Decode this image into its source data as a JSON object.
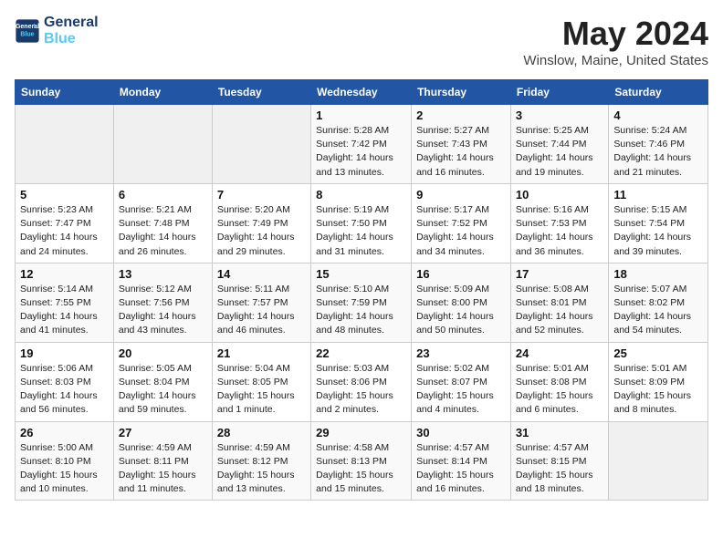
{
  "header": {
    "logo_line1": "General",
    "logo_line2": "Blue",
    "month": "May 2024",
    "location": "Winslow, Maine, United States"
  },
  "weekdays": [
    "Sunday",
    "Monday",
    "Tuesday",
    "Wednesday",
    "Thursday",
    "Friday",
    "Saturday"
  ],
  "weeks": [
    [
      {
        "day": "",
        "detail": ""
      },
      {
        "day": "",
        "detail": ""
      },
      {
        "day": "",
        "detail": ""
      },
      {
        "day": "1",
        "detail": "Sunrise: 5:28 AM\nSunset: 7:42 PM\nDaylight: 14 hours\nand 13 minutes."
      },
      {
        "day": "2",
        "detail": "Sunrise: 5:27 AM\nSunset: 7:43 PM\nDaylight: 14 hours\nand 16 minutes."
      },
      {
        "day": "3",
        "detail": "Sunrise: 5:25 AM\nSunset: 7:44 PM\nDaylight: 14 hours\nand 19 minutes."
      },
      {
        "day": "4",
        "detail": "Sunrise: 5:24 AM\nSunset: 7:46 PM\nDaylight: 14 hours\nand 21 minutes."
      }
    ],
    [
      {
        "day": "5",
        "detail": "Sunrise: 5:23 AM\nSunset: 7:47 PM\nDaylight: 14 hours\nand 24 minutes."
      },
      {
        "day": "6",
        "detail": "Sunrise: 5:21 AM\nSunset: 7:48 PM\nDaylight: 14 hours\nand 26 minutes."
      },
      {
        "day": "7",
        "detail": "Sunrise: 5:20 AM\nSunset: 7:49 PM\nDaylight: 14 hours\nand 29 minutes."
      },
      {
        "day": "8",
        "detail": "Sunrise: 5:19 AM\nSunset: 7:50 PM\nDaylight: 14 hours\nand 31 minutes."
      },
      {
        "day": "9",
        "detail": "Sunrise: 5:17 AM\nSunset: 7:52 PM\nDaylight: 14 hours\nand 34 minutes."
      },
      {
        "day": "10",
        "detail": "Sunrise: 5:16 AM\nSunset: 7:53 PM\nDaylight: 14 hours\nand 36 minutes."
      },
      {
        "day": "11",
        "detail": "Sunrise: 5:15 AM\nSunset: 7:54 PM\nDaylight: 14 hours\nand 39 minutes."
      }
    ],
    [
      {
        "day": "12",
        "detail": "Sunrise: 5:14 AM\nSunset: 7:55 PM\nDaylight: 14 hours\nand 41 minutes."
      },
      {
        "day": "13",
        "detail": "Sunrise: 5:12 AM\nSunset: 7:56 PM\nDaylight: 14 hours\nand 43 minutes."
      },
      {
        "day": "14",
        "detail": "Sunrise: 5:11 AM\nSunset: 7:57 PM\nDaylight: 14 hours\nand 46 minutes."
      },
      {
        "day": "15",
        "detail": "Sunrise: 5:10 AM\nSunset: 7:59 PM\nDaylight: 14 hours\nand 48 minutes."
      },
      {
        "day": "16",
        "detail": "Sunrise: 5:09 AM\nSunset: 8:00 PM\nDaylight: 14 hours\nand 50 minutes."
      },
      {
        "day": "17",
        "detail": "Sunrise: 5:08 AM\nSunset: 8:01 PM\nDaylight: 14 hours\nand 52 minutes."
      },
      {
        "day": "18",
        "detail": "Sunrise: 5:07 AM\nSunset: 8:02 PM\nDaylight: 14 hours\nand 54 minutes."
      }
    ],
    [
      {
        "day": "19",
        "detail": "Sunrise: 5:06 AM\nSunset: 8:03 PM\nDaylight: 14 hours\nand 56 minutes."
      },
      {
        "day": "20",
        "detail": "Sunrise: 5:05 AM\nSunset: 8:04 PM\nDaylight: 14 hours\nand 59 minutes."
      },
      {
        "day": "21",
        "detail": "Sunrise: 5:04 AM\nSunset: 8:05 PM\nDaylight: 15 hours\nand 1 minute."
      },
      {
        "day": "22",
        "detail": "Sunrise: 5:03 AM\nSunset: 8:06 PM\nDaylight: 15 hours\nand 2 minutes."
      },
      {
        "day": "23",
        "detail": "Sunrise: 5:02 AM\nSunset: 8:07 PM\nDaylight: 15 hours\nand 4 minutes."
      },
      {
        "day": "24",
        "detail": "Sunrise: 5:01 AM\nSunset: 8:08 PM\nDaylight: 15 hours\nand 6 minutes."
      },
      {
        "day": "25",
        "detail": "Sunrise: 5:01 AM\nSunset: 8:09 PM\nDaylight: 15 hours\nand 8 minutes."
      }
    ],
    [
      {
        "day": "26",
        "detail": "Sunrise: 5:00 AM\nSunset: 8:10 PM\nDaylight: 15 hours\nand 10 minutes."
      },
      {
        "day": "27",
        "detail": "Sunrise: 4:59 AM\nSunset: 8:11 PM\nDaylight: 15 hours\nand 11 minutes."
      },
      {
        "day": "28",
        "detail": "Sunrise: 4:59 AM\nSunset: 8:12 PM\nDaylight: 15 hours\nand 13 minutes."
      },
      {
        "day": "29",
        "detail": "Sunrise: 4:58 AM\nSunset: 8:13 PM\nDaylight: 15 hours\nand 15 minutes."
      },
      {
        "day": "30",
        "detail": "Sunrise: 4:57 AM\nSunset: 8:14 PM\nDaylight: 15 hours\nand 16 minutes."
      },
      {
        "day": "31",
        "detail": "Sunrise: 4:57 AM\nSunset: 8:15 PM\nDaylight: 15 hours\nand 18 minutes."
      },
      {
        "day": "",
        "detail": ""
      }
    ]
  ]
}
